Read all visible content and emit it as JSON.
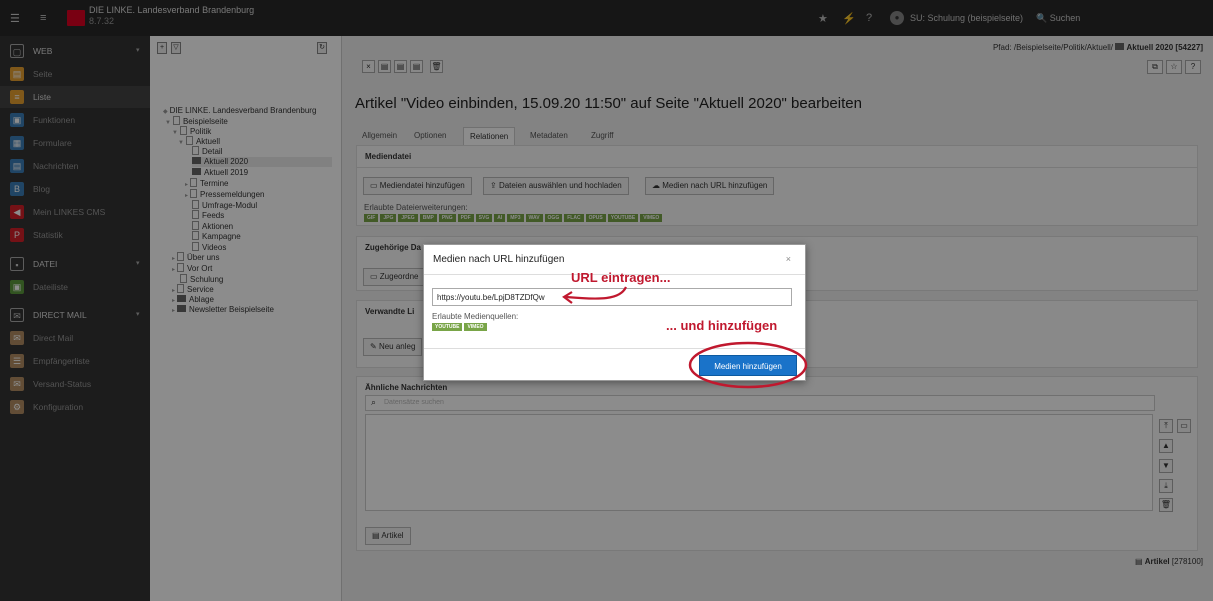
{
  "topbar": {
    "site_name": "DIE LINKE. Landesverband Brandenburg",
    "version": "8.7.32",
    "user": "SU: Schulung (beispielseite)",
    "search": "Suchen"
  },
  "sidebar": {
    "items": [
      {
        "label": "WEB",
        "icon": "page-icon",
        "color": "#444444"
      },
      {
        "label": "Seite",
        "icon": "page-icon",
        "color": "#e8a031"
      },
      {
        "label": "Liste",
        "icon": "list-icon",
        "color": "#e8a031"
      },
      {
        "label": "Funktionen",
        "icon": "functions-icon",
        "color": "#3b7fb8"
      },
      {
        "label": "Formulare",
        "icon": "form-icon",
        "color": "#3b7fb8"
      },
      {
        "label": "Nachrichten",
        "icon": "news-icon",
        "color": "#3b7fb8"
      },
      {
        "label": "Blog",
        "icon": "blog-icon",
        "color": "#3b7fb8"
      },
      {
        "label": "Mein LINKES CMS",
        "icon": "flag-icon",
        "color": "#d32028"
      },
      {
        "label": "Statistik",
        "icon": "stats-icon",
        "color": "#d32028"
      },
      {
        "label": "DATEI",
        "icon": "image-icon",
        "color": "#444444"
      },
      {
        "label": "Dateiliste",
        "icon": "files-icon",
        "color": "#5c9a3c"
      },
      {
        "label": "DIRECT MAIL",
        "icon": "mail-icon",
        "color": "#444444"
      },
      {
        "label": "Direct Mail",
        "icon": "mail-icon",
        "color": "#b38d63"
      },
      {
        "label": "Empfängerliste",
        "icon": "recipients-icon",
        "color": "#b38d63"
      },
      {
        "label": "Versand-Status",
        "icon": "status-icon",
        "color": "#b38d63"
      },
      {
        "label": "Konfiguration",
        "icon": "config-icon",
        "color": "#b38d63"
      }
    ]
  },
  "tree": {
    "items": [
      {
        "label": "DIE LINKE. Landesverband Brandenburg",
        "type": "root"
      },
      {
        "label": "Beispielseite",
        "type": "page"
      },
      {
        "label": "Politik",
        "type": "page"
      },
      {
        "label": "Aktuell",
        "type": "page"
      },
      {
        "label": "Detail",
        "type": "page"
      },
      {
        "label": "Aktuell 2020",
        "type": "folder"
      },
      {
        "label": "Aktuell 2019",
        "type": "folder"
      },
      {
        "label": "Termine",
        "type": "page"
      },
      {
        "label": "Pressemeldungen",
        "type": "page"
      },
      {
        "label": "Umfrage-Modul",
        "type": "page"
      },
      {
        "label": "Feeds",
        "type": "page"
      },
      {
        "label": "Aktionen",
        "type": "page"
      },
      {
        "label": "Kampagne",
        "type": "page"
      },
      {
        "label": "Videos",
        "type": "page"
      },
      {
        "label": "Über uns",
        "type": "page"
      },
      {
        "label": "Vor Ort",
        "type": "page"
      },
      {
        "label": "Schulung",
        "type": "page"
      },
      {
        "label": "Service",
        "type": "page"
      },
      {
        "label": "Ablage",
        "type": "folder"
      },
      {
        "label": "Newsletter Beispielseite",
        "type": "folder"
      }
    ]
  },
  "main": {
    "breadcrumb_prefix": "Pfad: /Beispielseite/Politik/Aktuell/",
    "breadcrumb_current": "Aktuell 2020 [54227]",
    "title": "Artikel \"Video einbinden, 15.09.20 11:50\" auf Seite \"Aktuell 2020\" bearbeiten",
    "tabs": [
      "Allgemein",
      "Optionen",
      "Relationen",
      "Metadaten",
      "Zugriff"
    ],
    "active_tab": "Relationen",
    "mediendatei": {
      "heading": "Mediendatei",
      "btn_add": "Mediendatei hinzufügen",
      "btn_upload": "Dateien auswählen und hochladen",
      "btn_url": "Medien nach URL hinzufügen",
      "ext_label": "Erlaubte Dateierweiterungen:",
      "exts": [
        "GIF",
        "JPG",
        "JPEG",
        "BMP",
        "PNG",
        "PDF",
        "SVG",
        "AI",
        "MP3",
        "WAV",
        "OGG",
        "FLAC",
        "OPUS",
        "YOUTUBE",
        "VIMEO"
      ]
    },
    "zugehoerige": {
      "heading": "Zugehörige Da",
      "btn": "Zugeordne"
    },
    "verwandte": {
      "heading": "Verwandte Li",
      "btn": "Neu anleg"
    },
    "aehnliche": {
      "heading": "Ähnliche Nachrichten",
      "search_placeholder": "Datensätze suchen",
      "artikel_btn": "Artikel"
    },
    "footer_artikel": "Artikel",
    "footer_id": "[278100]"
  },
  "modal": {
    "title": "Medien nach URL hinzufügen",
    "close": "×",
    "url_value": "https://youtu.be/LpjD8TZDfQw",
    "sources_label": "Erlaubte Medienquellen:",
    "sources": [
      "YOUTUBE",
      "VIMEO"
    ],
    "submit": "Medien hinzufügen"
  },
  "annotations": {
    "url_hint": "URL eintragen...",
    "add_hint": "... und hinzufügen",
    "color": "#c0182e"
  }
}
